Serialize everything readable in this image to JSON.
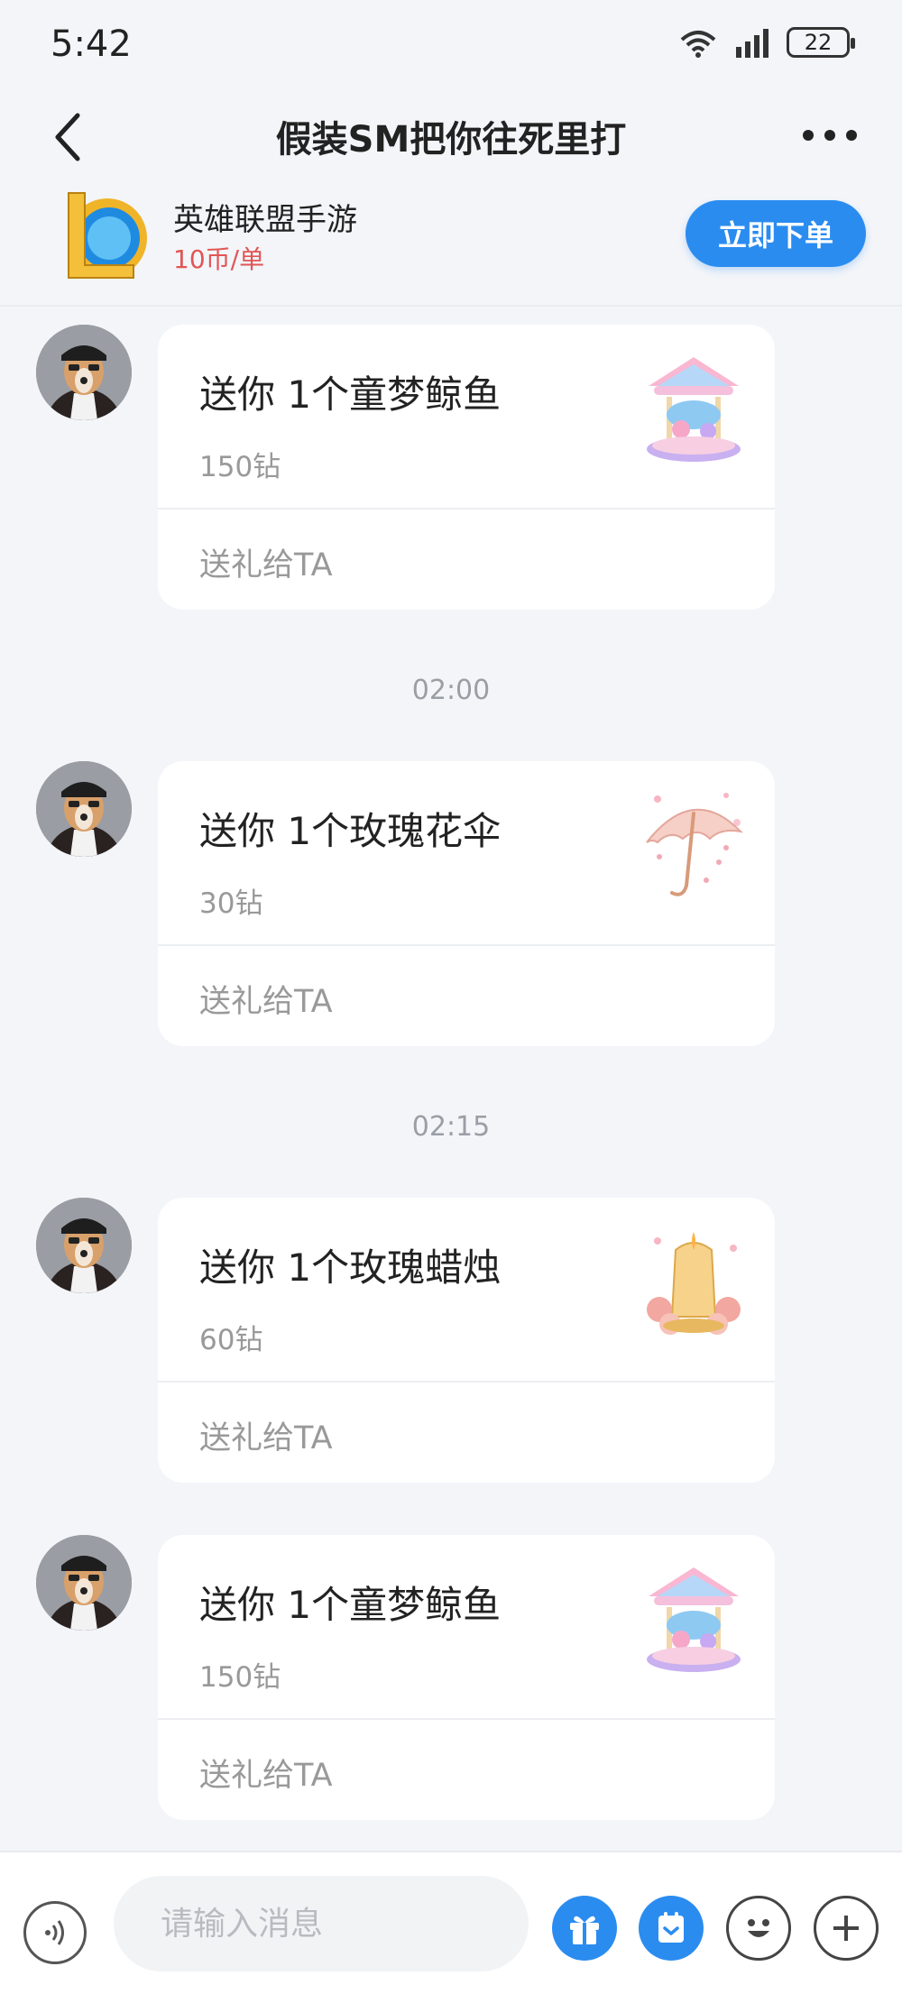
{
  "status": {
    "time": "5:42",
    "battery": "22",
    "icons": [
      "wifi-icon",
      "signal-icon",
      "battery-icon"
    ]
  },
  "nav": {
    "title": "假装SM把你往死里打",
    "back_icon": "chevron-left-icon",
    "more_icon": "more-dots-icon"
  },
  "service": {
    "name": "英雄联盟手游",
    "price": "10币/单",
    "order_label": "立即下单",
    "logo_icon": "game-logo-icon"
  },
  "messages": [
    {
      "gift": "送你 1个童梦鲸鱼",
      "price": "150钻",
      "action": "送礼给TA",
      "image": "carousel-gift"
    },
    {
      "gift": "送你 1个玫瑰花伞",
      "price": "30钻",
      "action": "送礼给TA",
      "image": "rose-umbrella-gift"
    },
    {
      "gift": "送你 1个玫瑰蜡烛",
      "price": "60钻",
      "action": "送礼给TA",
      "image": "rose-candle-gift"
    },
    {
      "gift": "送你 1个童梦鲸鱼",
      "price": "150钻",
      "action": "送礼给TA",
      "image": "carousel-gift"
    }
  ],
  "timestamps": [
    "02:00",
    "02:15"
  ],
  "input": {
    "placeholder": "请输入消息"
  },
  "toolbar": {
    "icons": [
      "voice-icon",
      "gift-icon",
      "calendar-icon",
      "emoji-icon",
      "plus-icon"
    ]
  },
  "colors": {
    "accent": "#2b8cf0",
    "price": "#e25555",
    "background": "#f3f5f9"
  }
}
